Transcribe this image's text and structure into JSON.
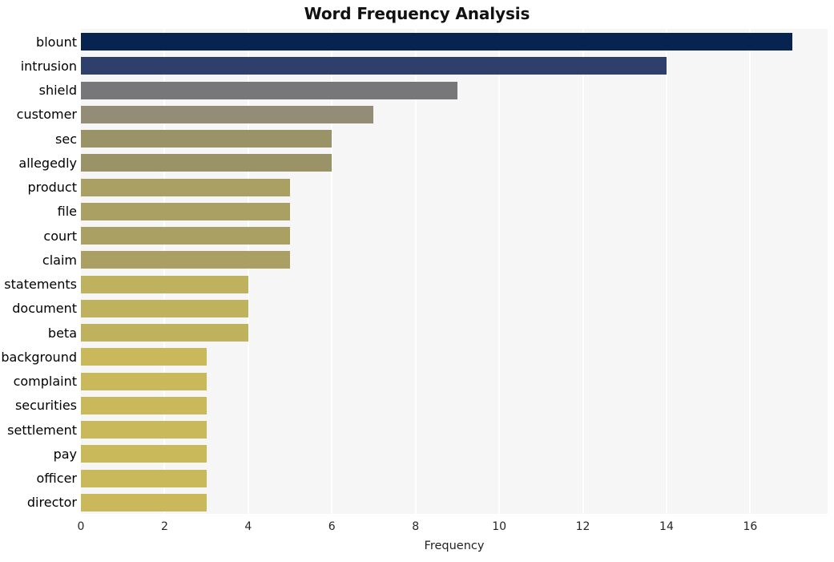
{
  "chart_data": {
    "type": "bar",
    "orientation": "horizontal",
    "title": "Word Frequency Analysis",
    "xlabel": "Frequency",
    "ylabel": "",
    "categories": [
      "blount",
      "intrusion",
      "shield",
      "customer",
      "sec",
      "allegedly",
      "product",
      "file",
      "court",
      "claim",
      "statements",
      "document",
      "beta",
      "background",
      "complaint",
      "securities",
      "settlement",
      "pay",
      "officer",
      "director"
    ],
    "values": [
      17,
      14,
      9,
      7,
      6,
      6,
      5,
      5,
      5,
      5,
      4,
      4,
      4,
      3,
      3,
      3,
      3,
      3,
      3,
      3
    ],
    "bar_colors": [
      "#06244f",
      "#2e3f6b",
      "#77777a",
      "#938d78",
      "#9a9367",
      "#9a9368",
      "#aaa063",
      "#aaa063",
      "#aaa063",
      "#aaa063",
      "#bfb25e",
      "#bfb25e",
      "#bfb25e",
      "#c9b95b",
      "#c9b95b",
      "#c9b95b",
      "#c9b95b",
      "#c9b95b",
      "#c9b95b",
      "#c9b95b"
    ],
    "xticks": [
      0,
      2,
      4,
      6,
      8,
      10,
      12,
      14,
      16
    ],
    "xtick_labels": [
      "0",
      "2",
      "4",
      "6",
      "8",
      "10",
      "12",
      "14",
      "16"
    ],
    "xlim": [
      0,
      17.85
    ],
    "grid": "vertical-only",
    "gridline_color": "#ffffff",
    "plot_background": "#f6f6f7",
    "figure_background": "#ffffff",
    "legend": "none"
  }
}
